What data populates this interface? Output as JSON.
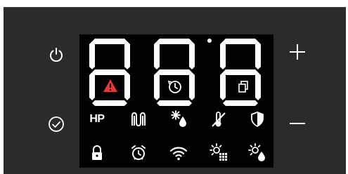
{
  "controls": {
    "power": {
      "icon": "power-icon"
    },
    "confirm": {
      "icon": "check-circle-icon"
    },
    "plus": {
      "icon": "plus-icon"
    },
    "minus": {
      "icon": "minus-icon"
    }
  },
  "display": {
    "digits": [
      "8",
      "8",
      "8"
    ],
    "digit_color": "#ffffff",
    "digit_overlays": [
      "alarm-warning-icon",
      "timer-icon",
      "copy-icon"
    ],
    "decimal_point": true,
    "indicators_row1": [
      {
        "name": "hp-indicator",
        "label": "HP"
      },
      {
        "name": "heater-coil-icon"
      },
      {
        "name": "defrost-icon"
      },
      {
        "name": "temperature-off-icon"
      },
      {
        "name": "shield-icon"
      }
    ],
    "indicators_row2": [
      {
        "name": "lock-icon"
      },
      {
        "name": "alarm-clock-icon"
      },
      {
        "name": "wifi-icon"
      },
      {
        "name": "light-grid-icon"
      },
      {
        "name": "light-drop-icon"
      }
    ]
  },
  "colors": {
    "panel": "#2b2b2b",
    "display": "#000000",
    "segment": "#ffffff",
    "alert": "#e53935"
  }
}
